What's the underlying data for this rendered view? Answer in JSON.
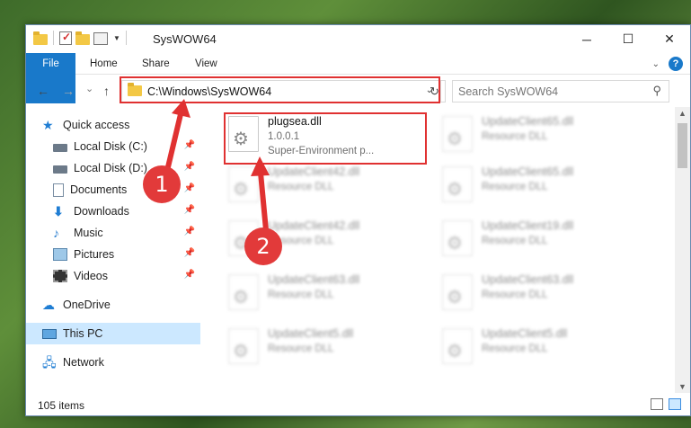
{
  "window": {
    "title": "SysWOW64",
    "controls": {
      "minimize": "─",
      "maximize": "☐",
      "close": "✕"
    }
  },
  "ribbon": {
    "tabs": [
      {
        "label": "File"
      },
      {
        "label": "Home"
      },
      {
        "label": "Share"
      },
      {
        "label": "View"
      }
    ]
  },
  "nav": {
    "back": "←",
    "forward": "→",
    "recent": "⌄",
    "up": "↑",
    "address": "C:\\Windows\\SysWOW64",
    "search_placeholder": "Search SysWOW64"
  },
  "sidebar": {
    "quick_access": "Quick access",
    "items": [
      {
        "label": "Local Disk (C:)",
        "icon": "disk-icon"
      },
      {
        "label": "Local Disk (D:)",
        "icon": "disk-icon"
      },
      {
        "label": "Documents",
        "icon": "documents-icon"
      },
      {
        "label": "Downloads",
        "icon": "downloads-icon"
      },
      {
        "label": "Music",
        "icon": "music-icon"
      },
      {
        "label": "Pictures",
        "icon": "pictures-icon"
      },
      {
        "label": "Videos",
        "icon": "videos-icon"
      }
    ],
    "onedrive": "OneDrive",
    "this_pc": "This PC",
    "network": "Network"
  },
  "files": {
    "highlighted": {
      "name": "plugsea.dll",
      "version": "1.0.0.1",
      "description": "Super-Environment p..."
    },
    "blurred": [
      {
        "name": "UpdateClient65.dll",
        "type": "Resource DLL"
      },
      {
        "name": "UpdateClient42.dll",
        "type": "Resource DLL"
      },
      {
        "name": "UpdateClient65.dll",
        "type": "Resource DLL"
      },
      {
        "name": "UpdateClient42.dll",
        "type": "Resource DLL"
      },
      {
        "name": "UpdateClient19.dll",
        "type": "Resource DLL"
      },
      {
        "name": "UpdateClient63.dll",
        "type": "Resource DLL"
      },
      {
        "name": "UpdateClient63.dll",
        "type": "Resource DLL"
      },
      {
        "name": "UpdateClient5.dll",
        "type": "Resource DLL"
      },
      {
        "name": "UpdateClient5.dll",
        "type": "Resource DLL"
      }
    ]
  },
  "status": {
    "item_count": "105 items"
  },
  "annotations": {
    "step1": "1",
    "step2": "2"
  },
  "colors": {
    "accent": "#1979ca",
    "highlight": "#e03131",
    "selection": "#cce8ff"
  }
}
